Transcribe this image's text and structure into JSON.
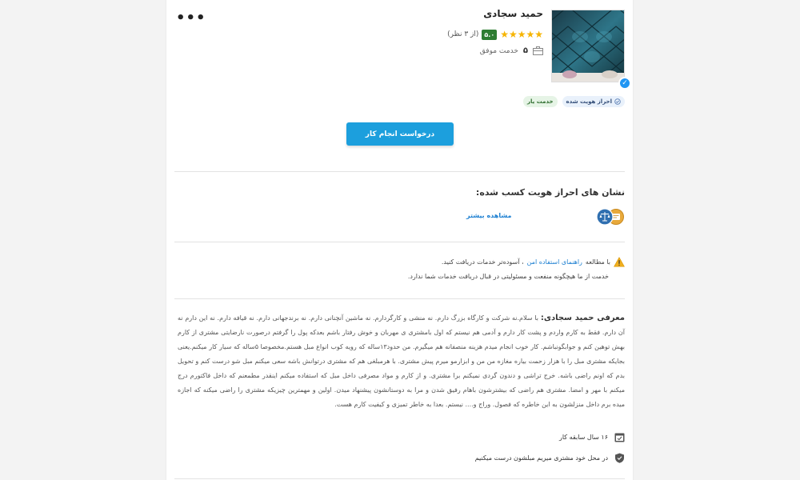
{
  "profile": {
    "name": "حمید سجادی",
    "rating_value": "۵.۰",
    "rating_count": "(از ۳ نظر)",
    "stars": "★★★★★",
    "stars_fraction": 1.0,
    "successful_jobs_count": "۵",
    "successful_jobs_label": "خدمت موفق",
    "more_menu": "•••",
    "verified_mark": "✓"
  },
  "tags": {
    "identity_verified": "احراز هویت شده",
    "service_provider": "خدمت یار"
  },
  "actions": {
    "request_label": "درخواست انجام کار"
  },
  "badges": {
    "title": "نشان های احراز هویت کسب شده:",
    "see_more": "مشاهده بیشتر"
  },
  "notice": {
    "prefix": "با مطالعه",
    "guide_link": "راهنمای استفاده امن",
    "suffix": "، آسوده‌تر خدمات دریافت کنید.",
    "disclaimer": "خدمت از ما هیچگونه منفعت و مسئولیتی در قبال دریافت خدمات شما ندارد."
  },
  "intro": {
    "label": "معرفی حمید سجادی:",
    "text": "با سلام.نه شرکت و کارگاه بزرگ دارم. نه منشی و کارگردارم. نه ماشین آنچنانی دارم. نه برندجهانی دارم. نه قیافه دارم. نه این دارم نه آن دارم. فقط به کارم واردم و پشت کار دارم و آدمی هم نیستم که اول بامشتری ی مهربان و خوش رفتار باشم بعدکه پول را گرفتم درصورت نارضایتی مشتری از کارم بهش توهین کنم و جوابگونباشم. کار خوب انجام میدم هزینه منصفانه هم میگیرم. من حدود۱۳ساله که رویه کوب انواع مبل هستم.مخصوصا ۵ساله که سیار کار میکنم.یعنی بجایکه مشتری مبل را با هزار زحمت بیاره مغازه من من و ابزارمو میرم پیش مشتری. با هرمبلغی هم که مشتری درتوانش باشه سعی میکنم مبل شو درست کنم و تحویل بدم که اونم راضی باشه. خرج تراشی و دندون گردی نمیکنم برا مشتری. و از کارم و مواد مصرفی داخل مبل که استفاده میکنم اینقدر مطمعنم که داخل فاکتورم درج میکنم با مهر و امضا. مشتری هم راضی که بیشترشون باهام رفیق شدن و مرا به دوستانشون پیشنهاد میدن. اولین و مهمترین چیزیکه مشتری را راضی میکنه که اجازه میده برم داخل منزلشون به این خاطره که فصول. وراج و.... نیستم. بعدا به خاطر تمیزی و کیفیت کارم هست."
  },
  "features": {
    "experience": "۱۶ سال سابقه کار",
    "onsite": "در محل خود مشتری میریم مبلشون درست میکنیم"
  },
  "colors": {
    "accent_blue": "#1c9fdd",
    "link_blue": "#1c7fd1",
    "score_green": "#2e7d32",
    "star_yellow": "#f6b400"
  }
}
